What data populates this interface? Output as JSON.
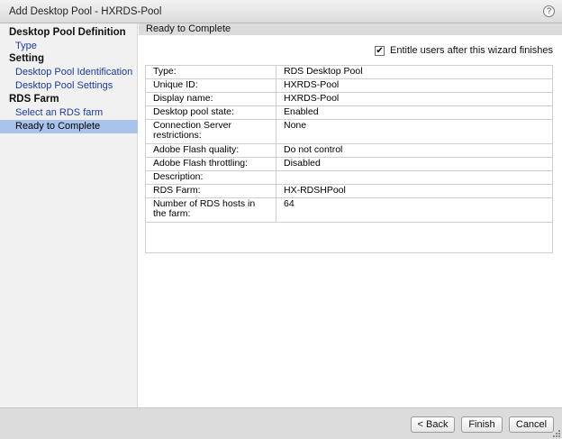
{
  "window": {
    "title": "Add Desktop Pool - HXRDS-Pool",
    "help_icon": "?"
  },
  "sidebar": {
    "sections": [
      {
        "label": "Desktop Pool Definition",
        "items": [
          {
            "label": "Type"
          }
        ]
      },
      {
        "label": "Setting",
        "items": [
          {
            "label": "Desktop Pool Identification"
          },
          {
            "label": "Desktop Pool Settings"
          }
        ]
      },
      {
        "label": "RDS Farm",
        "items": [
          {
            "label": "Select an RDS farm"
          },
          {
            "label": "Ready to Complete",
            "selected": true
          }
        ]
      }
    ]
  },
  "main": {
    "header": "Ready to Complete",
    "entitle": {
      "label": "Entitle users after this wizard finishes",
      "checked": true,
      "check_glyph": "✔"
    },
    "summary_rows": [
      {
        "key": "Type:",
        "value": "RDS Desktop Pool"
      },
      {
        "key": "Unique ID:",
        "value": "HXRDS-Pool"
      },
      {
        "key": "Display name:",
        "value": "HXRDS-Pool"
      },
      {
        "key": "Desktop pool state:",
        "value": "Enabled"
      },
      {
        "key": "Connection Server restrictions:",
        "value": "None"
      },
      {
        "key": "Adobe Flash quality:",
        "value": "Do not control"
      },
      {
        "key": "Adobe Flash throttling:",
        "value": "Disabled"
      },
      {
        "key": "Description:",
        "value": ""
      },
      {
        "key": "RDS Farm:",
        "value": "HX-RDSHPool"
      },
      {
        "key": "Number of RDS hosts in the farm:",
        "value": "64"
      }
    ]
  },
  "footer": {
    "back_label": "< Back",
    "finish_label": "Finish",
    "cancel_label": "Cancel"
  },
  "colors": {
    "selected_bg": "#a9c3ea",
    "link": "#1a3aa8",
    "header_bg": "#dcdcdc"
  }
}
